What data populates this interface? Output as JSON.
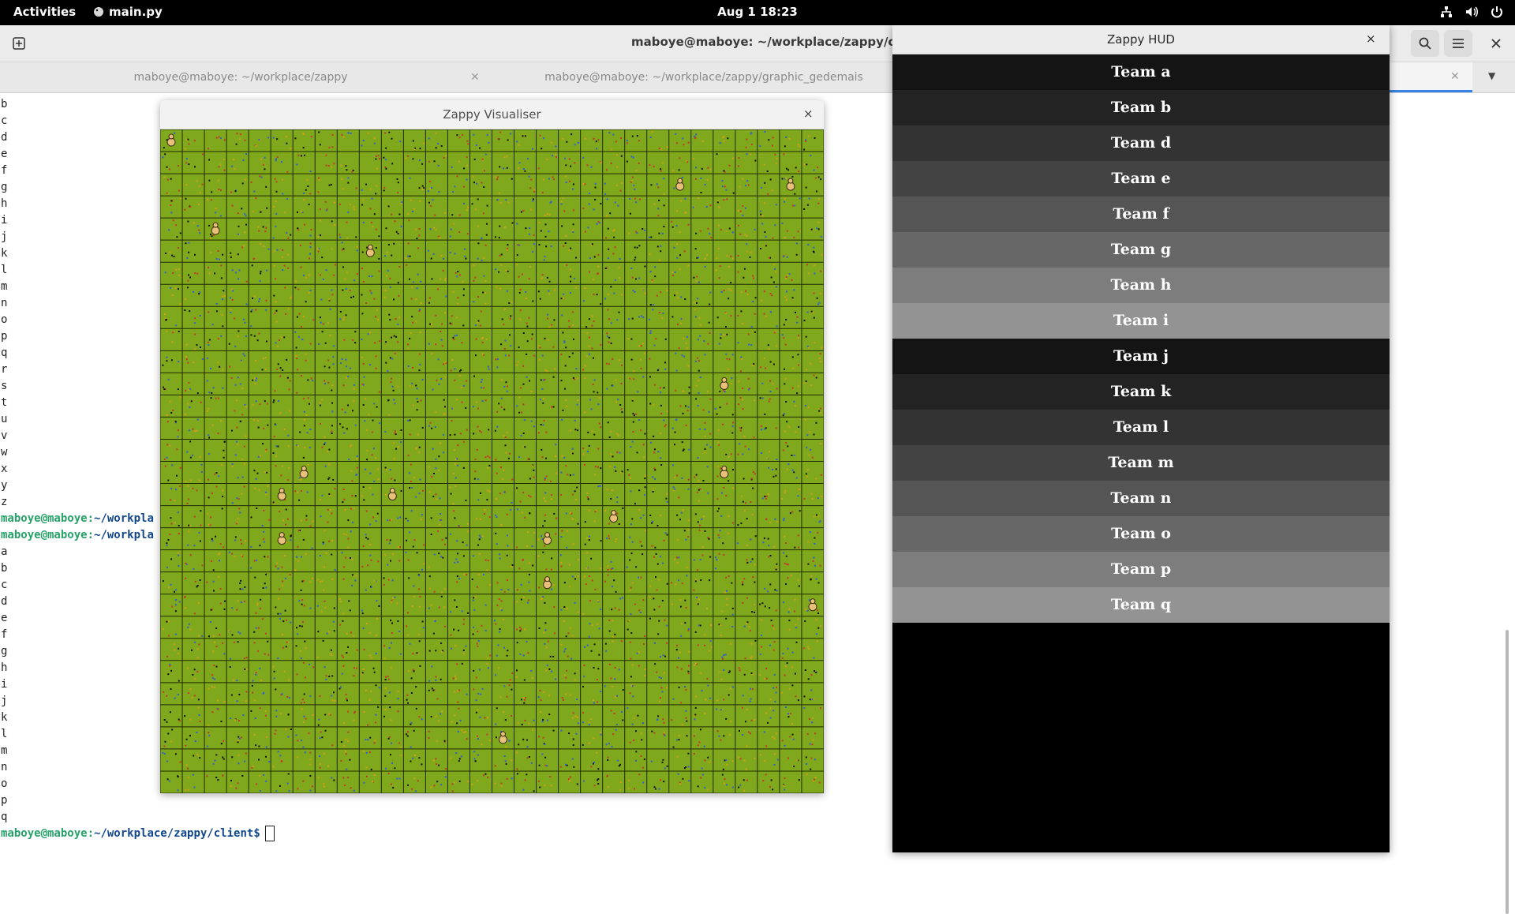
{
  "topbar": {
    "activities": "Activities",
    "app_name": "main.py",
    "app_icon": "python-icon",
    "clock": "Aug 1  18:23",
    "tray_icons": [
      "network-icon",
      "volume-icon",
      "power-icon"
    ]
  },
  "terminal": {
    "title": "maboye@maboye: ~/workplace/zappy/client",
    "tabs": [
      {
        "label": "maboye@maboye: ~/workplace/zappy"
      },
      {
        "label": "maboye@maboye: ~/workplace/zappy/graphic_gedemais"
      },
      {
        "label": ""
      }
    ],
    "lines_block1": [
      "b",
      "c",
      "d",
      "e",
      "f",
      "g",
      "h",
      "i",
      "j",
      "k",
      "l",
      "m",
      "n",
      "o",
      "p",
      "q",
      "r",
      "s",
      "t",
      "u",
      "v",
      "w",
      "x",
      "y",
      "z"
    ],
    "prompt_user": "maboye@maboye",
    "prompt_sep": ":",
    "prompt_partial_path": "~/workpla",
    "prompt_full_path": "~/workplace/zappy/client",
    "prompt_symbol": "$",
    "lines_block2": [
      "a",
      "b",
      "c",
      "d",
      "e",
      "f",
      "g",
      "h",
      "i",
      "j",
      "k",
      "l",
      "m",
      "n",
      "o",
      "p",
      "q"
    ]
  },
  "visualiser": {
    "title": "Zappy Visualiser",
    "close_glyph": "×",
    "map": {
      "grid_cols": 30,
      "grid_rows": 30,
      "ground_color": "#7fa81c",
      "grid_line_color": "#1f2a05",
      "resource_colors": [
        "#c0392b",
        "#2f5fd0",
        "#111111",
        "#d4a017"
      ],
      "player_color": "#e8c07a",
      "players": [
        {
          "col": 0,
          "row": 0
        },
        {
          "col": 23,
          "row": 2
        },
        {
          "col": 28,
          "row": 2
        },
        {
          "col": 2,
          "row": 4
        },
        {
          "col": 9,
          "row": 5
        },
        {
          "col": 25,
          "row": 11
        },
        {
          "col": 6,
          "row": 15
        },
        {
          "col": 25,
          "row": 15
        },
        {
          "col": 5,
          "row": 16
        },
        {
          "col": 10,
          "row": 16
        },
        {
          "col": 20,
          "row": 17
        },
        {
          "col": 5,
          "row": 18
        },
        {
          "col": 17,
          "row": 18
        },
        {
          "col": 17,
          "row": 20
        },
        {
          "col": 29,
          "row": 21
        },
        {
          "col": 15,
          "row": 27
        }
      ]
    }
  },
  "hud": {
    "title": "Zappy HUD",
    "close_glyph": "×",
    "teams": [
      {
        "name": "Team a",
        "color": "#141414"
      },
      {
        "name": "Team b",
        "color": "#232323"
      },
      {
        "name": "Team d",
        "color": "#333333"
      },
      {
        "name": "Team e",
        "color": "#434343"
      },
      {
        "name": "Team f",
        "color": "#555555"
      },
      {
        "name": "Team g",
        "color": "#676767"
      },
      {
        "name": "Team h",
        "color": "#7d7d7d"
      },
      {
        "name": "Team i",
        "color": "#939393"
      },
      {
        "name": "Team j",
        "color": "#141414"
      },
      {
        "name": "Team k",
        "color": "#232323"
      },
      {
        "name": "Team l",
        "color": "#333333"
      },
      {
        "name": "Team m",
        "color": "#434343"
      },
      {
        "name": "Team n",
        "color": "#555555"
      },
      {
        "name": "Team o",
        "color": "#676767"
      },
      {
        "name": "Team p",
        "color": "#7d7d7d"
      },
      {
        "name": "Team q",
        "color": "#939393"
      }
    ]
  }
}
